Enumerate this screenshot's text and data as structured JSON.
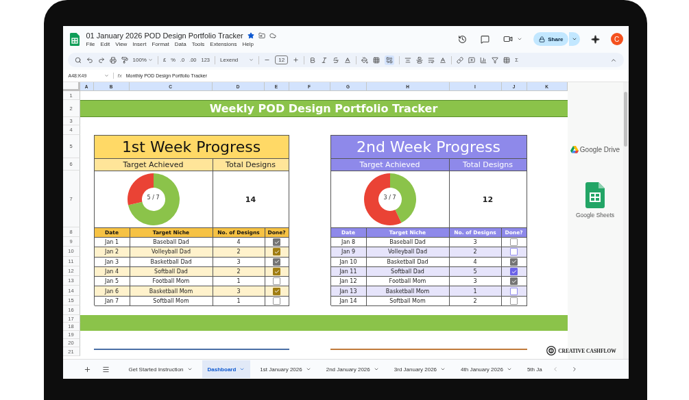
{
  "document": {
    "title": "01 January 2026 POD Design Portfolio Tracker",
    "starred": true
  },
  "menu": [
    "File",
    "Edit",
    "View",
    "Insert",
    "Format",
    "Data",
    "Tools",
    "Extensions",
    "Help"
  ],
  "share": {
    "label": "Share"
  },
  "account": {
    "initial": "C"
  },
  "toolbar": {
    "zoom": "100%",
    "currency": "£",
    "percent": "%",
    "decrease_decimal": ".0",
    "increase_decimal": ".00",
    "number_format": "123",
    "font": "Lexend",
    "font_size": "12",
    "functions": "Σ"
  },
  "formula_bar": {
    "cell_ref": "A48:K49",
    "fx": "fx",
    "content": "Monthly POD Design Portfolio Tracker"
  },
  "columns": [
    "A",
    "B",
    "C",
    "D",
    "E",
    "F",
    "G",
    "H",
    "I",
    "J",
    "K"
  ],
  "rows": [
    "1",
    "2",
    "3",
    "4",
    "5",
    "6",
    "7",
    "8",
    "9",
    "10",
    "11",
    "12",
    "13",
    "14",
    "15",
    "16",
    "17",
    "18",
    "19",
    "20",
    "21"
  ],
  "banner": "Weekly POD Design Portfolio Tracker",
  "weeks": [
    {
      "kind": "gold",
      "title": "1st Week Progress",
      "target_label": "Target Achieved",
      "total_label": "Total Designs",
      "ratio": "5 / 7",
      "total": "14",
      "chart_data": {
        "type": "donut",
        "values": [
          71.43,
          28.57
        ]
      },
      "headers": [
        "Date",
        "Target Niche",
        "No. of Designs",
        "Done?"
      ],
      "entries": [
        {
          "date": "Jan 1",
          "niche": "Baseball Dad",
          "designs": "4",
          "done": true
        },
        {
          "date": "Jan 2",
          "niche": "Volleyball Dad",
          "designs": "2",
          "done": true
        },
        {
          "date": "Jan 3",
          "niche": "Basketball Dad",
          "designs": "3",
          "done": true
        },
        {
          "date": "Jan 4",
          "niche": "Softball Dad",
          "designs": "2",
          "done": true
        },
        {
          "date": "Jan 5",
          "niche": "Football Mom",
          "designs": "1",
          "done": false
        },
        {
          "date": "Jan 6",
          "niche": "Basketball Mom",
          "designs": "3",
          "done": true
        },
        {
          "date": "Jan 7",
          "niche": "Softball Mom",
          "designs": "1",
          "done": false
        }
      ]
    },
    {
      "kind": "violet",
      "title": "2nd Week Progress",
      "target_label": "Target Achieved",
      "total_label": "Total Designs",
      "ratio": "3 / 7",
      "total": "12",
      "chart_data": {
        "type": "donut",
        "values": [
          42.86,
          57.14
        ]
      },
      "headers": [
        "Date",
        "Target Niche",
        "No. of Designs",
        "Done?"
      ],
      "entries": [
        {
          "date": "Jan 8",
          "niche": "Baseball Dad",
          "designs": "3",
          "done": false
        },
        {
          "date": "Jan 9",
          "niche": "Volleyball Dad",
          "designs": "2",
          "done": false
        },
        {
          "date": "Jan 10",
          "niche": "Basketball Dad",
          "designs": "4",
          "done": true
        },
        {
          "date": "Jan 11",
          "niche": "Softball Dad",
          "designs": "5",
          "done": true
        },
        {
          "date": "Jan 12",
          "niche": "Football Mom",
          "designs": "3",
          "done": true
        },
        {
          "date": "Jan 13",
          "niche": "Basketball Mom",
          "designs": "1",
          "done": false
        },
        {
          "date": "Jan 14",
          "niche": "Softball Mom",
          "designs": "2",
          "done": false
        }
      ]
    }
  ],
  "logos": {
    "drive": "Google Drive",
    "sheets": "Google Sheets",
    "brand": "CREATIVE CASHFLOW"
  },
  "sheet_tabs": [
    {
      "label": "Get Started Instruction",
      "selected": false
    },
    {
      "label": "Dashboard",
      "selected": true
    },
    {
      "label": "1st January 2026",
      "selected": false
    },
    {
      "label": "2nd January 2026",
      "selected": false
    },
    {
      "label": "3rd January 2026",
      "selected": false
    },
    {
      "label": "4th January 2026",
      "selected": false
    },
    {
      "label": "5th Ja",
      "selected": false
    }
  ]
}
